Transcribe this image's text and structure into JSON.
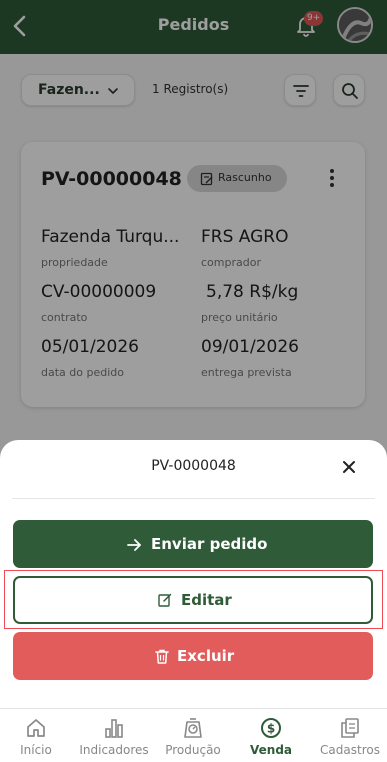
{
  "header": {
    "title": "Pedidos",
    "notification_badge": "9+"
  },
  "filters": {
    "property_filter_value": "Fazen...",
    "record_count": "1 Registro(s)"
  },
  "order_card": {
    "code": "PV-00000048",
    "status": "Rascunho",
    "property_value": "Fazenda Turqu...",
    "property_label": "propriedade",
    "buyer_value": "FRS AGRO",
    "buyer_label": "comprador",
    "contract_value": "CV-00000009",
    "contract_label": "contrato",
    "unit_price_value": "5,78 R$/kg",
    "unit_price_label": "preço unitário",
    "order_date_value": "05/01/2026",
    "order_date_label": "data do pedido",
    "delivery_date_value": "09/01/2026",
    "delivery_date_label": "entrega prevista"
  },
  "sheet": {
    "title": "PV-0000048",
    "send_label": "Enviar pedido",
    "edit_label": "Editar",
    "delete_label": "Excluir"
  },
  "tabbar": {
    "items": [
      {
        "label": "Início",
        "icon": "home-icon"
      },
      {
        "label": "Indicadores",
        "icon": "bar-chart-icon"
      },
      {
        "label": "Produção",
        "icon": "scale-icon"
      },
      {
        "label": "Venda",
        "icon": "dollar-circle-icon"
      },
      {
        "label": "Cadastros",
        "icon": "copy-icon"
      }
    ],
    "active": "Venda"
  },
  "colors": {
    "primary": "#2f5b38",
    "danger": "#e25c5c",
    "badge": "#e25656",
    "highlight": "#ef4b55"
  }
}
